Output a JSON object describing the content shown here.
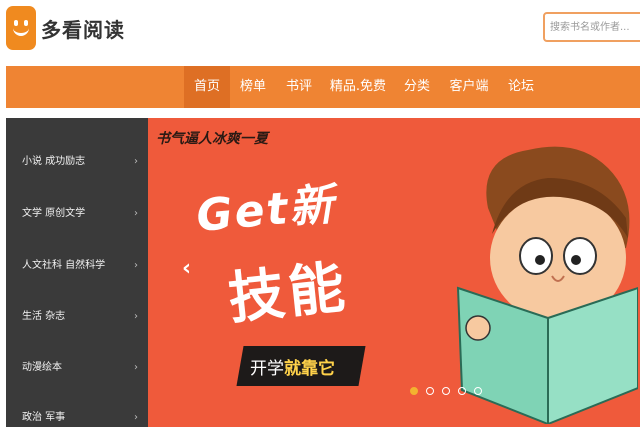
{
  "brand": {
    "name": "多看阅读",
    "color": "#f08a1f"
  },
  "search": {
    "placeholder": "搜索书名或作者..."
  },
  "nav": {
    "items": [
      {
        "label": "首页",
        "active": true
      },
      {
        "label": "榜单"
      },
      {
        "label": "书评"
      },
      {
        "label": "精品.免费"
      },
      {
        "label": "分类"
      },
      {
        "label": "客户端"
      },
      {
        "label": "论坛"
      }
    ]
  },
  "sidebar": {
    "items": [
      {
        "label": "小说  成功励志",
        "arrow": "›"
      },
      {
        "label": "文学  原创文学",
        "arrow": "›"
      },
      {
        "label": "人文社科  自然科学",
        "arrow": "›"
      },
      {
        "label": "生活  杂志",
        "arrow": "›"
      },
      {
        "label": "动漫绘本",
        "arrow": "›"
      },
      {
        "label": "政治  军事",
        "arrow": "›"
      }
    ]
  },
  "banner": {
    "slogan": "书气逼人冰爽一夏",
    "headline_line1": "Get新",
    "headline_line2": "技能",
    "sub_pre": "开学",
    "sub_bold": "就靠它",
    "prev_arrow": "‹",
    "slide_count": 5,
    "active_slide": 0
  }
}
